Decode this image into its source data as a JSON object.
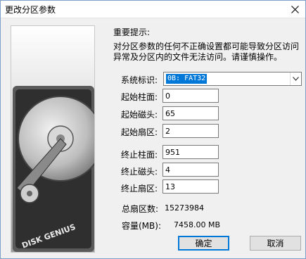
{
  "window": {
    "title": "更改分区参数"
  },
  "image": {
    "brand_text": "DISK GENIUS"
  },
  "hint": {
    "title": "重要提示:",
    "line1": "对分区参数的任何不正确设置都可能导致分区访问",
    "line2": "异常及分区内的文件无法访问。请谨慎操作。"
  },
  "system_id": {
    "label": "系统标识:",
    "value": "0B: FAT32"
  },
  "start": {
    "cylinder": {
      "label": "起始柱面:",
      "value": "0"
    },
    "head": {
      "label": "起始磁头:",
      "value": "65"
    },
    "sector": {
      "label": "起始扇区:",
      "value": "2"
    }
  },
  "end": {
    "cylinder": {
      "label": "终止柱面:",
      "value": "951"
    },
    "head": {
      "label": "终止磁头:",
      "value": "4"
    },
    "sector": {
      "label": "终止扇区:",
      "value": "13"
    }
  },
  "total_sectors": {
    "label": "总扇区数:",
    "value": "15273984"
  },
  "capacity": {
    "label": "容量(MB):",
    "value": "7458.00 MB"
  },
  "buttons": {
    "ok": "确定",
    "cancel": "取消"
  }
}
